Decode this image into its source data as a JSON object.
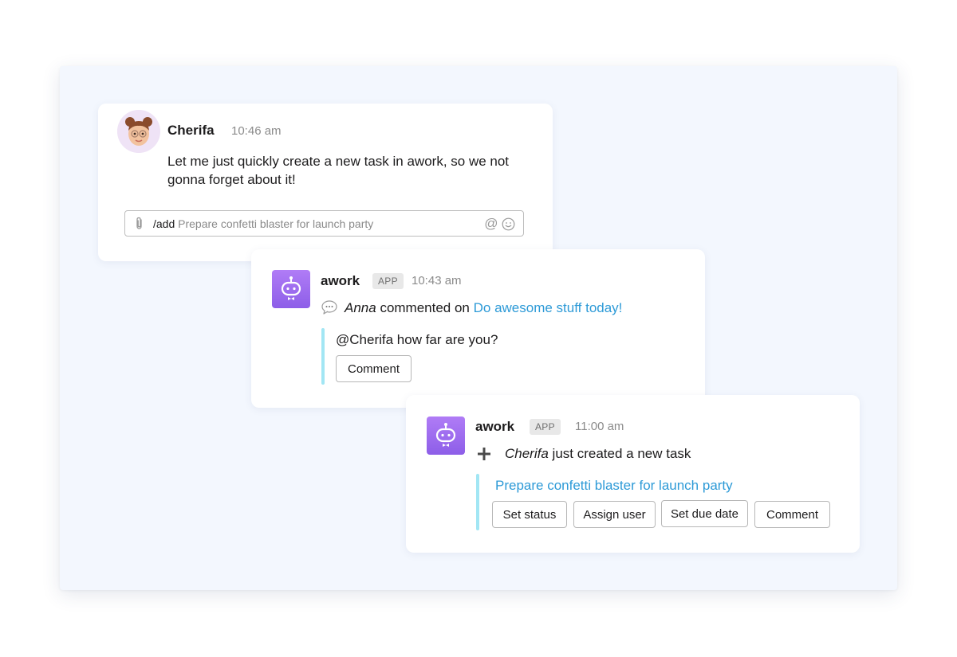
{
  "message1": {
    "author": "Cherifa",
    "time": "10:46 am",
    "text": "Let me just quickly create a new task in awork, so we not gonna forget about it!",
    "composer": {
      "command": "/add",
      "value": "Prepare confetti blaster for launch party"
    }
  },
  "message2": {
    "author": "awork",
    "badge": "APP",
    "time": "10:43 am",
    "actor": "Anna",
    "action": "commented on",
    "task_link": "Do awesome stuff today!",
    "quote": "@Cherifa how far are you?",
    "button": "Comment"
  },
  "message3": {
    "author": "awork",
    "badge": "APP",
    "time": "11:00 am",
    "actor": "Cherifa",
    "action": "just created a new task",
    "task_link": "Prepare confetti blaster for launch party",
    "buttons": [
      "Set status",
      "Assign user",
      "Set due date",
      "Comment"
    ]
  },
  "icons": {
    "attach": "paperclip-icon",
    "mention": "at-icon",
    "emoji": "smiley-icon",
    "comment": "speech-bubble-icon",
    "create": "plus-icon",
    "bot": "robot-icon"
  },
  "colors": {
    "link": "#2d9ad7",
    "quote_bar": "#a2e6f4",
    "bot_purple": "#9b6cf0",
    "background": "#f3f7fe"
  }
}
